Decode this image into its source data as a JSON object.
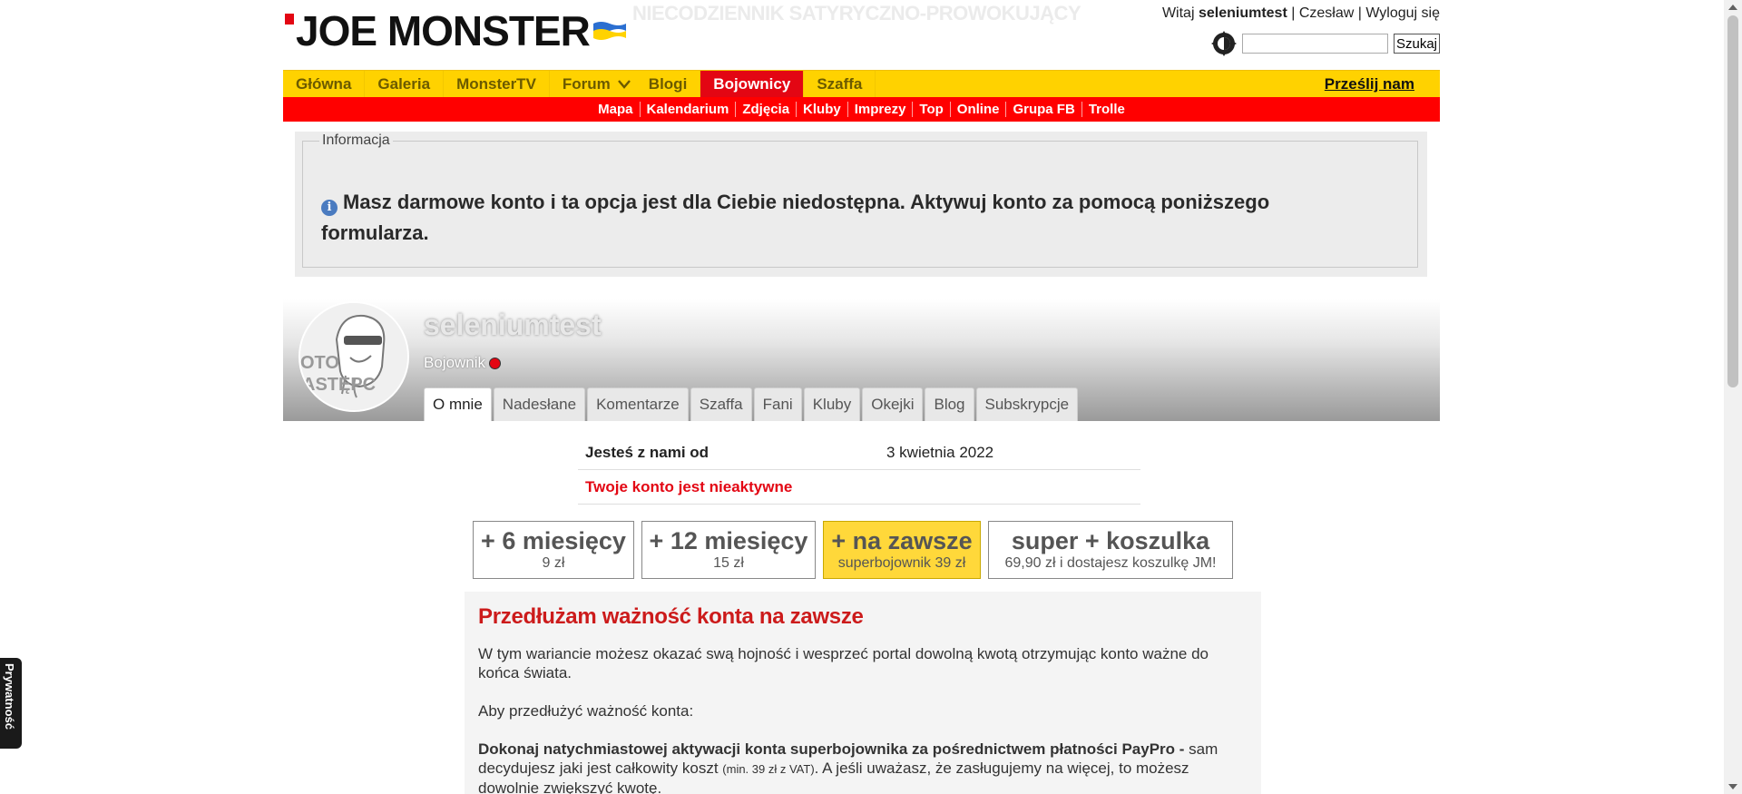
{
  "header": {
    "logo_text": "JOE MONSTER",
    "tagline": "NIECODZIENNIK SATYRYCZNO-PROWOKUJĄCY",
    "greeting": "Witaj",
    "username": "seleniumtest",
    "city_link": "Czesław",
    "logout_link": "Wyloguj się",
    "search_button": "Szukaj",
    "search_value": ""
  },
  "nav": {
    "items": [
      {
        "label": "Główna"
      },
      {
        "label": "Galeria"
      },
      {
        "label": "MonsterTV"
      },
      {
        "label": "Forum"
      },
      {
        "label": "Blogi"
      },
      {
        "label": "Bojownicy"
      },
      {
        "label": "Szaffa"
      }
    ],
    "active": "Bojownicy",
    "right_link": "Prześlij nam"
  },
  "subnav": {
    "items": [
      "Mapa",
      "Kalendarium",
      "Zdjęcia",
      "Kluby",
      "Imprezy",
      "Top",
      "Online",
      "Grupa FB",
      "Trolle"
    ]
  },
  "info": {
    "legend": "Informacja",
    "message": "Masz darmowe konto i ta opcja jest dla Ciebie niedostępna. Aktywuj konto za pomocą poniższego formularza."
  },
  "profile": {
    "name": "seleniumtest",
    "rank": "Bojownik",
    "tabs": [
      "O mnie",
      "Nadesłane",
      "Komentarze",
      "Szaffa",
      "Fani",
      "Kluby",
      "Okejki",
      "Blog",
      "Subskrypcje"
    ],
    "active_tab": "O mnie",
    "avatar_text_1": "OTO",
    "avatar_text_2": "ASTĘPC"
  },
  "details": {
    "joined_label": "Jesteś z nami od",
    "joined_value": "3 kwietnia 2022",
    "inactive_notice": "Twoje konto jest nieaktywne"
  },
  "plans": [
    {
      "title": "+ 6 miesięcy",
      "sub": "9 zł",
      "active": false
    },
    {
      "title": "+ 12 miesięcy",
      "sub": "15 zł",
      "active": false
    },
    {
      "title": "+ na zawsze",
      "sub": "superbojownik 39 zł",
      "active": true
    },
    {
      "title": "super + koszulka",
      "sub": "69,90 zł i dostajesz koszulkę JM!",
      "active": false
    }
  ],
  "description": {
    "heading": "Przedłużam ważność konta na zawsze",
    "p1": "W tym wariancie możesz okazać swą hojność i wesprzeć portal dowolną kwotą otrzymując konto ważne do końca świata.",
    "p2": "Aby przedłużyć ważność konta:",
    "p3_bold": "Dokonaj natychmiastowej aktywacji konta superbojownika za pośrednictwem płatności PayPro -",
    "p3_a": " sam decydujesz jaki jest całkowity koszt ",
    "p3_small": "(min. 39 zł z VAT)",
    "p3_b": ". A jeśli uważasz, że zasługujemy na więcej, to możesz dowolnie zwiększyć kwotę."
  },
  "privacy": {
    "label": "Prywatność"
  },
  "colors": {
    "nav_yellow": "#ffd200",
    "accent_red": "#e30613",
    "subnav_red": "#ff0000",
    "heading_red": "#cc1b1b"
  }
}
